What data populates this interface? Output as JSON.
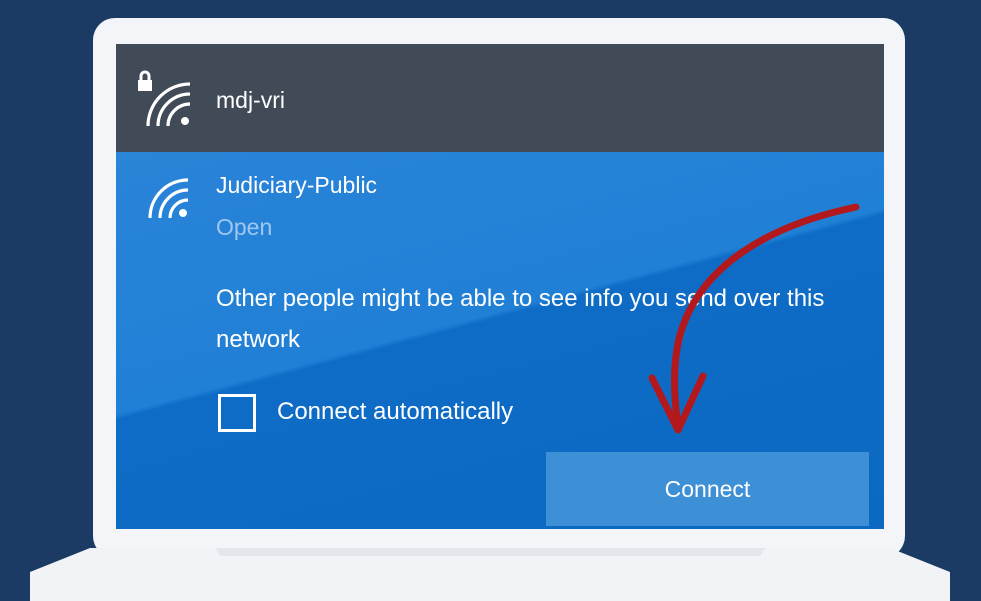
{
  "networks": [
    {
      "name": "mdj-vri",
      "secured": true,
      "icons": [
        "lock-icon",
        "wifi-icon"
      ]
    },
    {
      "name": "Judiciary-Public",
      "status": "Open",
      "warning": "Other people might be able to see info you send over this network",
      "connect_automatically_label": "Connect automatically",
      "connect_automatically_checked": false,
      "connect_button_label": "Connect",
      "icons": [
        "wifi-icon"
      ]
    }
  ],
  "colors": {
    "background": "#1b3a64",
    "selected_panel": "#0c6dc8",
    "top_row": "#414a57",
    "button": "#3d8fd6",
    "annotation_arrow": "#b3191c"
  },
  "annotation": "arrow pointing to connect button"
}
